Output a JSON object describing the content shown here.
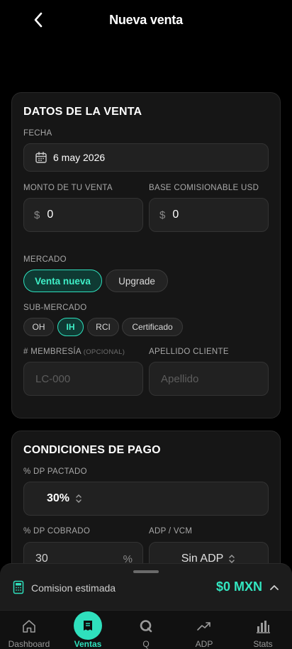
{
  "header": {
    "title": "Nueva venta"
  },
  "sale": {
    "title": "DATOS DE LA VENTA",
    "date_label": "FECHA",
    "date_value": "6 may 2026",
    "amount_label": "MONTO DE TU VENTA",
    "amount_currency": "$",
    "amount_value": "0",
    "base_label": "BASE COMISIONABLE USD",
    "base_currency": "$",
    "base_value": "0",
    "market_label": "MERCADO",
    "market_options": [
      "Venta nueva",
      "Upgrade"
    ],
    "market_selected": "Venta nueva",
    "submarket_label": "SUB-MERCADO",
    "submarket_options": [
      "OH",
      "IH",
      "RCI",
      "Certificado"
    ],
    "submarket_selected": "IH",
    "membership_label": "# MEMBRESÍA",
    "membership_optional": "(OPCIONAL)",
    "membership_placeholder": "LC-000",
    "lastname_label": "APELLIDO CLIENTE",
    "lastname_placeholder": "Apellido"
  },
  "payment": {
    "title": "CONDICIONES DE PAGO",
    "dp_agreed_label": "% DP PACTADO",
    "dp_agreed_value": "30%",
    "dp_collected_label": "% DP COBRADO",
    "dp_collected_value": "30",
    "dp_collected_unit": "%",
    "adp_label": "ADP / VCM",
    "adp_value": "Sin ADP"
  },
  "commission": {
    "label": "Comision estimada",
    "value": "$0 MXN"
  },
  "nav": {
    "items": [
      {
        "label": "Dashboard",
        "icon": "home-icon"
      },
      {
        "label": "Ventas",
        "icon": "receipt-icon",
        "active": true
      },
      {
        "label": "Q",
        "icon": "q-icon"
      },
      {
        "label": "ADP",
        "icon": "trend-icon"
      },
      {
        "label": "Stats",
        "icon": "bar-chart-icon"
      }
    ]
  },
  "colors": {
    "accent": "#2fe0bd",
    "background": "#000000",
    "card": "#161616"
  }
}
